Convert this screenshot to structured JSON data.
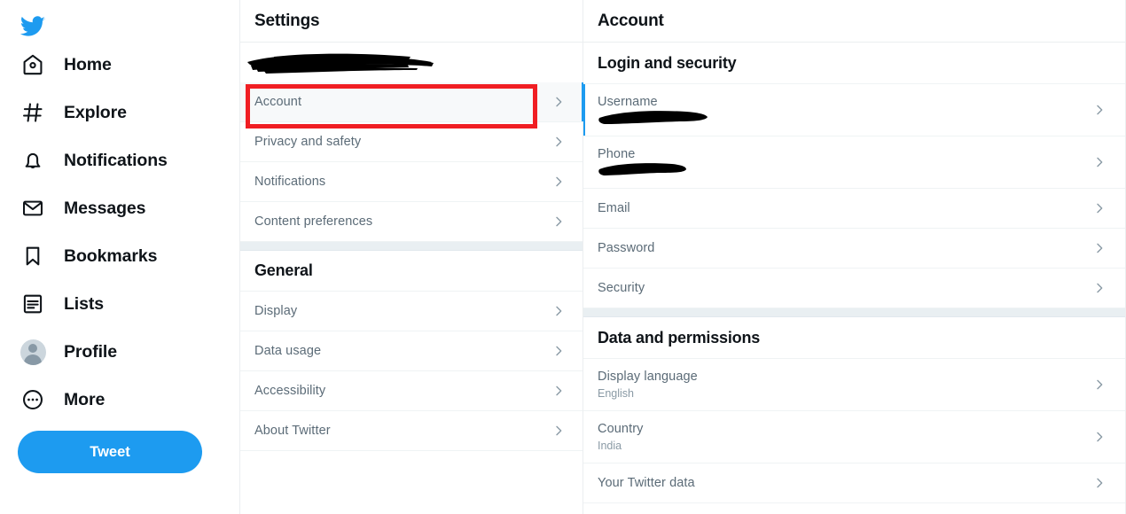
{
  "brand": {
    "logo_icon": "twitter-bird-icon",
    "accent_color": "#1d9bf0",
    "highlight_color": "#f01e23"
  },
  "sidebar": {
    "items": [
      {
        "label": "Home",
        "icon": "home-icon"
      },
      {
        "label": "Explore",
        "icon": "hashtag-icon"
      },
      {
        "label": "Notifications",
        "icon": "bell-icon"
      },
      {
        "label": "Messages",
        "icon": "envelope-icon"
      },
      {
        "label": "Bookmarks",
        "icon": "bookmark-icon"
      },
      {
        "label": "Lists",
        "icon": "list-icon"
      },
      {
        "label": "Profile",
        "icon": "avatar-icon"
      },
      {
        "label": "More",
        "icon": "more-circle-icon"
      }
    ],
    "tweet_button": "Tweet"
  },
  "settings_panel": {
    "header": "Settings",
    "account_handle_redacted": "",
    "sections": [
      {
        "title": "",
        "items": [
          {
            "label": "Account",
            "selected": true,
            "highlighted": true
          },
          {
            "label": "Privacy and safety",
            "selected": false,
            "highlighted": false
          },
          {
            "label": "Notifications",
            "selected": false,
            "highlighted": false
          },
          {
            "label": "Content preferences",
            "selected": false,
            "highlighted": false
          }
        ]
      },
      {
        "title": "General",
        "items": [
          {
            "label": "Display",
            "selected": false,
            "highlighted": false
          },
          {
            "label": "Data usage",
            "selected": false,
            "highlighted": false
          },
          {
            "label": "Accessibility",
            "selected": false,
            "highlighted": false
          },
          {
            "label": "About Twitter",
            "selected": false,
            "highlighted": false
          }
        ]
      }
    ]
  },
  "account_panel": {
    "header": "Account",
    "sections": [
      {
        "title": "Login and security",
        "items": [
          {
            "label": "Username",
            "sub": "",
            "redacted": true,
            "active": true
          },
          {
            "label": "Phone",
            "sub": "",
            "redacted": true,
            "active": false
          },
          {
            "label": "Email",
            "sub": "",
            "redacted": false,
            "active": false
          },
          {
            "label": "Password",
            "sub": "",
            "redacted": false,
            "active": false
          },
          {
            "label": "Security",
            "sub": "",
            "redacted": false,
            "active": false
          }
        ]
      },
      {
        "title": "Data and permissions",
        "items": [
          {
            "label": "Display language",
            "sub": "English",
            "redacted": false,
            "active": false
          },
          {
            "label": "Country",
            "sub": "India",
            "redacted": false,
            "active": false
          },
          {
            "label": "Your Twitter data",
            "sub": "",
            "redacted": false,
            "active": false
          }
        ]
      }
    ]
  }
}
